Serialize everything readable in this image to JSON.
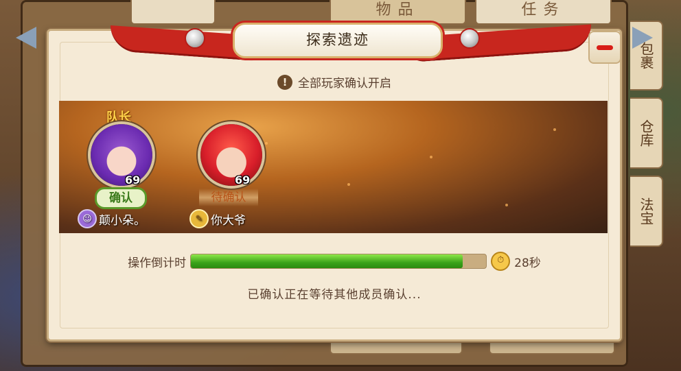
{
  "background": {
    "tabs": [
      "物品",
      "任务"
    ],
    "side_tabs": [
      "包裹",
      "仓库",
      "法宝"
    ]
  },
  "dialog": {
    "title": "探索遗迹",
    "notice_icon": "!",
    "notice": "全部玩家确认开启",
    "players": [
      {
        "role": "队长",
        "level": "69",
        "status": "确认",
        "name": "颠小朵。",
        "avatar_icon": "purple-hair-girl-avatar"
      },
      {
        "role": "",
        "level": "69",
        "status": "待确认",
        "name": "你大爷",
        "avatar_icon": "red-hair-boy-avatar"
      }
    ],
    "timer": {
      "label": "操作倒计时",
      "progress": 0.92,
      "remaining": "28秒"
    },
    "wait_message": "已确认正在等待其他成员确认..."
  },
  "colors": {
    "accent_red": "#c8261e",
    "progress_green": "#3aa21a",
    "confirm_green": "#5a9a2a",
    "pending_orange": "#b8551a"
  }
}
